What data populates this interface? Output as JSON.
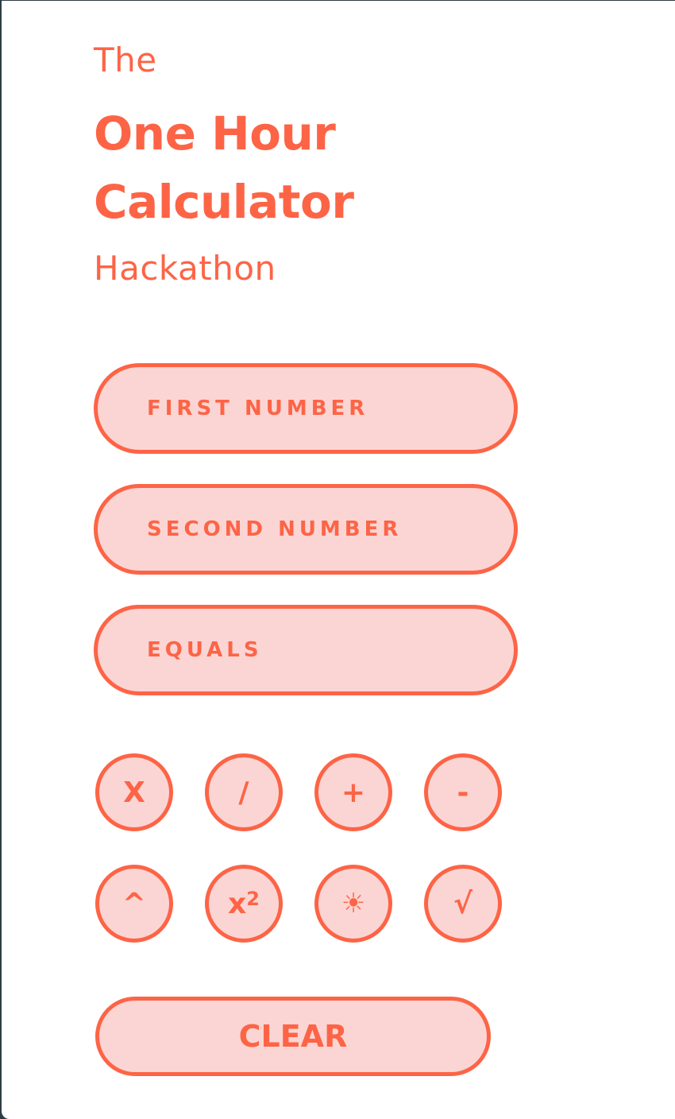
{
  "header": {
    "pre": "The",
    "line1": "One Hour",
    "line2": "Calculator",
    "post": "Hackathon"
  },
  "inputs": {
    "first_placeholder": "FIRST NUMBER",
    "second_placeholder": "SECOND NUMBER",
    "equals_placeholder": "EQUALS"
  },
  "operators": {
    "multiply": "X",
    "divide": "/",
    "add": "+",
    "subtract": "-",
    "power": "^",
    "square_base": "x",
    "square_exp": "2",
    "sun": "☀",
    "sqrt": "√"
  },
  "clear_label": "CLEAR",
  "colors": {
    "accent": "#fd6446",
    "fill": "#fbd5d4",
    "background": "#ffffff"
  }
}
